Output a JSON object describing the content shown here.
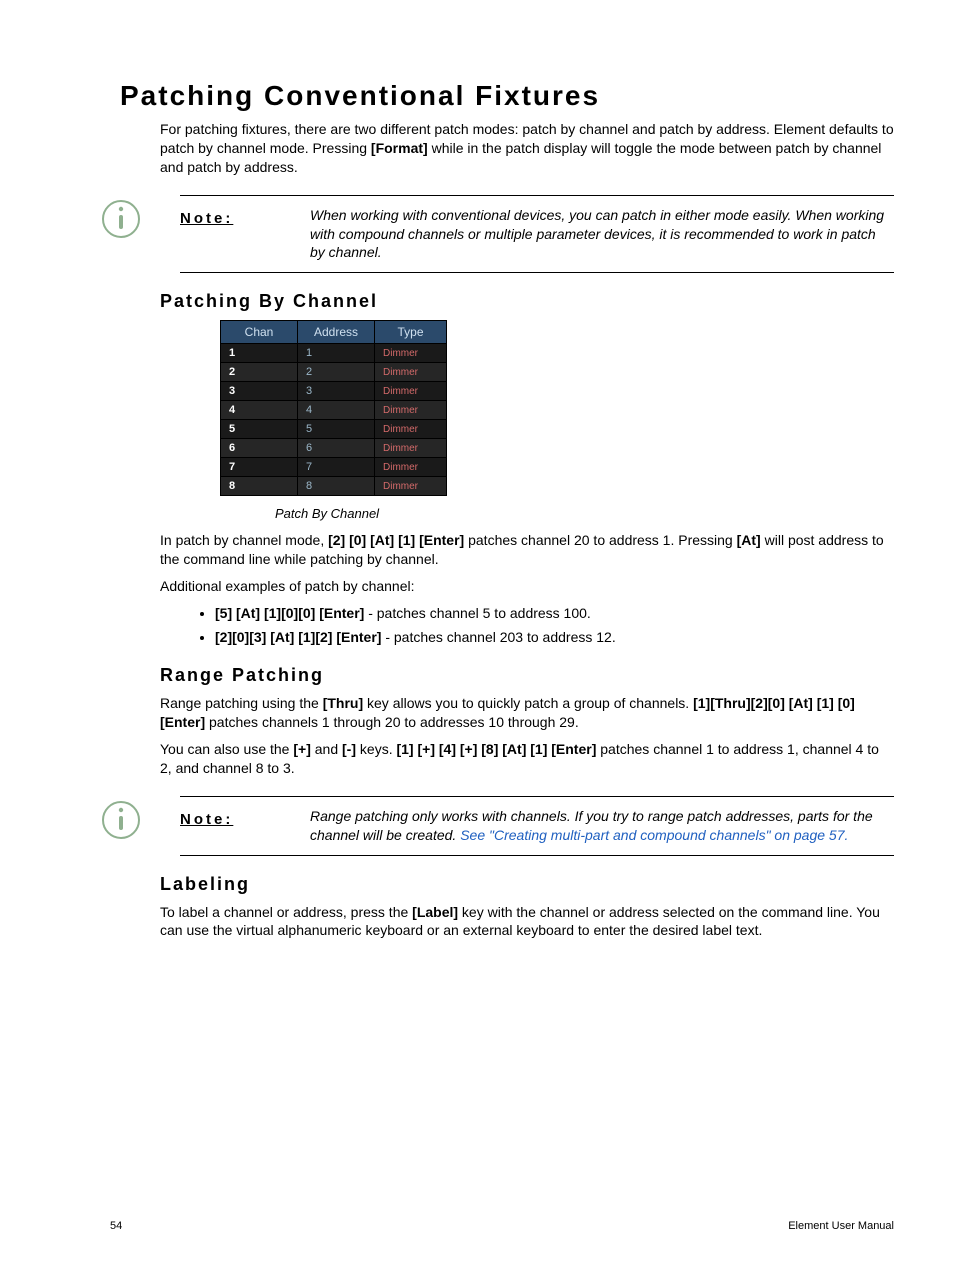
{
  "title": "Patching Conventional Fixtures",
  "intro": {
    "p1a": "For patching fixtures, there are two different patch modes: patch by channel and patch by address. Element defaults to patch by channel mode. Pressing ",
    "p1b": "[Format]",
    "p1c": " while in the patch display will toggle the mode between patch by channel and patch by address."
  },
  "note1": {
    "label": "Note:",
    "text": "When working with conventional devices, you can patch in either mode easily. When working with compound channels or multiple parameter devices, it is recommended to work in patch by channel."
  },
  "section_by_channel": {
    "title": "Patching By Channel",
    "table": {
      "headers": {
        "chan": "Chan",
        "address": "Address",
        "type": "Type"
      },
      "rows": [
        {
          "chan": "1",
          "address": "1",
          "type": "Dimmer"
        },
        {
          "chan": "2",
          "address": "2",
          "type": "Dimmer"
        },
        {
          "chan": "3",
          "address": "3",
          "type": "Dimmer"
        },
        {
          "chan": "4",
          "address": "4",
          "type": "Dimmer"
        },
        {
          "chan": "5",
          "address": "5",
          "type": "Dimmer"
        },
        {
          "chan": "6",
          "address": "6",
          "type": "Dimmer"
        },
        {
          "chan": "7",
          "address": "7",
          "type": "Dimmer"
        },
        {
          "chan": "8",
          "address": "8",
          "type": "Dimmer"
        }
      ],
      "caption": "Patch By Channel"
    },
    "p1a": "In patch by channel mode, ",
    "p1b": "[2] [0] [At] [1] [Enter]",
    "p1c": " patches channel 20 to address 1. Pressing ",
    "p1d": "[At]",
    "p1e": " will post address to the command line while patching by channel.",
    "p2": "Additional examples of patch by channel:",
    "bullets": [
      {
        "b": "[5] [At] [1][0][0] [Enter]",
        "rest": " - patches channel 5 to address 100."
      },
      {
        "b": "[2][0][3] [At] [1][2] [Enter]",
        "rest": " - patches channel 203 to address 12."
      }
    ]
  },
  "section_range": {
    "title": "Range Patching",
    "p1a": "Range patching using the ",
    "p1b": "[Thru]",
    "p1c": " key allows you to quickly patch a group of channels. ",
    "p1d": "[1][Thru][2][0] [At] [1] [0] [Enter]",
    "p1e": " patches channels 1 through 20 to addresses 10 through 29.",
    "p2a": "You can also use the ",
    "p2b": "[+]",
    "p2c": " and ",
    "p2d": "[-]",
    "p2e": " keys. ",
    "p2f": "[1] [+] [4] [+] [8] [At] [1] [Enter]",
    "p2g": " patches channel 1 to address 1, channel 4 to 2, and channel 8 to 3."
  },
  "note2": {
    "label": "Note:",
    "text_a": "Range patching only works with channels. If you try to range patch addresses, parts for the channel will be created. ",
    "link": "See \"Creating multi-part and compound channels\" on page 57."
  },
  "section_label": {
    "title": "Labeling",
    "p1a": "To label a channel or address, press the ",
    "p1b": "[Label]",
    "p1c": " key with the channel or address selected on the command line. You can use the virtual alphanumeric keyboard or an external keyboard to enter the desired label text."
  },
  "footer": {
    "page": "54",
    "doc": "Element User Manual"
  }
}
